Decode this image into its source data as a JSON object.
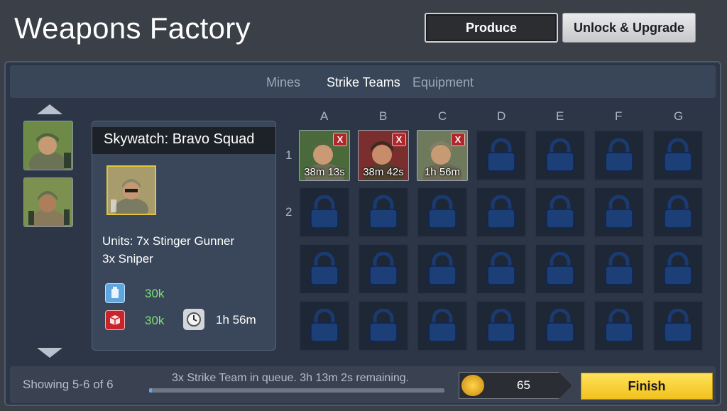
{
  "header": {
    "title": "Weapons Factory",
    "produce_label": "Produce",
    "unlock_label": "Unlock & Upgrade"
  },
  "tabs": [
    {
      "label": "Mines",
      "active": false
    },
    {
      "label": "Strike Teams",
      "active": true
    },
    {
      "label": "Equipment",
      "active": false
    }
  ],
  "detail": {
    "name": "Skywatch: Bravo Squad",
    "units_line1": "Units: 7x Stinger Gunner",
    "units_line2": "3x Sniper",
    "cost_oil": "30k",
    "cost_supplies": "30k",
    "build_time": "1h 56m"
  },
  "grid": {
    "columns": [
      "A",
      "B",
      "C",
      "D",
      "E",
      "F",
      "G"
    ],
    "rows": [
      "1",
      "2",
      "",
      ""
    ],
    "queue": [
      {
        "timer": "38m 13s",
        "cancel": "X"
      },
      {
        "timer": "38m 42s",
        "cancel": "X"
      },
      {
        "timer": "1h 56m",
        "cancel": "X"
      }
    ]
  },
  "footer": {
    "showing": "Showing 5-6 of 6",
    "queue_status": "3x Strike Team in queue. 3h 13m 2s remaining.",
    "progress": 0.01,
    "gold_cost": "65",
    "finish_label": "Finish"
  },
  "colors": {
    "accent_yellow": "#f1c21e",
    "resource_green": "#7fe07a",
    "cancel_red": "#b0262b",
    "lock_blue": "#1c3f78"
  }
}
